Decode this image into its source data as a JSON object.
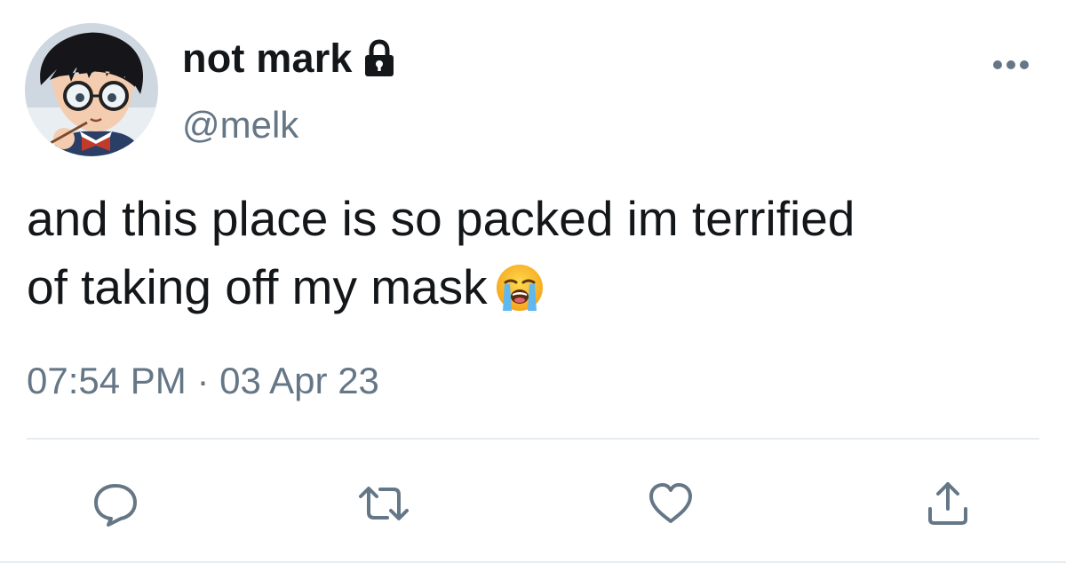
{
  "tweet": {
    "display_name": "not mark",
    "handle": "@melk",
    "protected_icon": "lock-icon",
    "text_lines": [
      "and this place is so packed im terrified",
      "of taking off my mask"
    ],
    "emoji": "loudly-crying-face",
    "timestamp": "07:54 PM · 03 Apr 23"
  },
  "actions": {
    "reply_icon": "speech-bubble-icon",
    "retweet_icon": "retweet-icon",
    "like_icon": "heart-icon",
    "share_icon": "share-upload-icon"
  },
  "colors": {
    "text": "#14171a",
    "secondary": "#657786",
    "divider": "#e6ecf0"
  }
}
